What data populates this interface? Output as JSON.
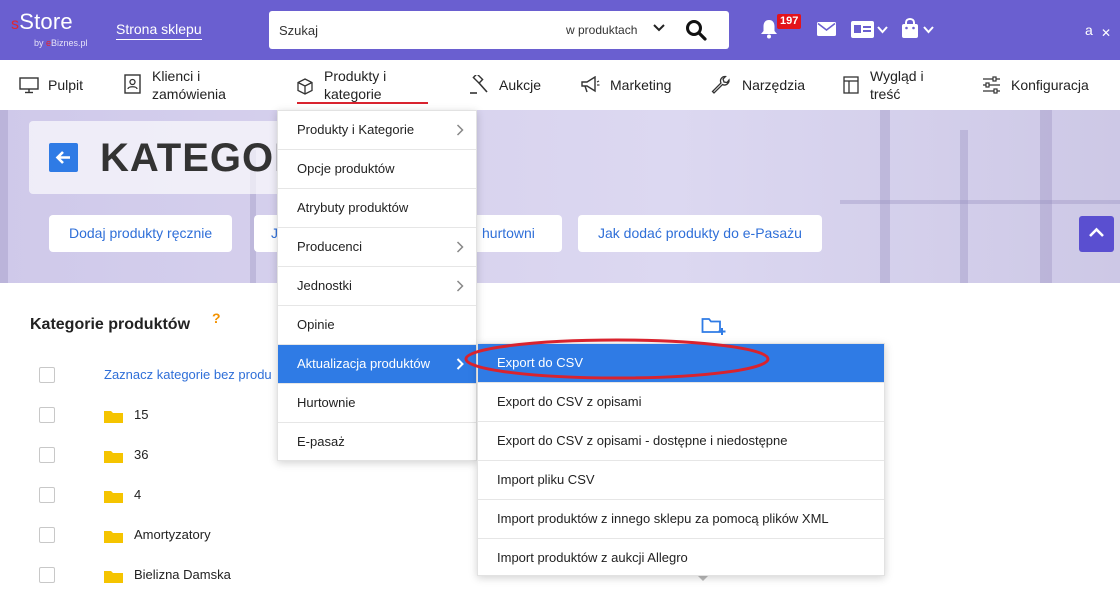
{
  "topbar": {
    "logo_s": "s",
    "logo_main": "Store",
    "logo_by": "by ",
    "logo_e": "e",
    "logo_biznes": "Biznes.pl",
    "shop_link": "Strona sklepu",
    "search_placeholder": "Szukaj",
    "search_scope": "w produktach",
    "notifications_count": "197",
    "user_letter": "a",
    "close_glyph": "✕"
  },
  "nav": {
    "items": [
      {
        "label1": "Pulpit",
        "label2": "",
        "icon": "monitor-icon"
      },
      {
        "label1": "Klienci i",
        "label2": "zamówienia",
        "icon": "client-card-icon"
      },
      {
        "label1": "Produkty i",
        "label2": "kategorie",
        "icon": "box-icon"
      },
      {
        "label1": "Aukcje",
        "label2": "",
        "icon": "gavel-icon"
      },
      {
        "label1": "Marketing",
        "label2": "",
        "icon": "megaphone-icon"
      },
      {
        "label1": "Narzędzia",
        "label2": "",
        "icon": "wrench-icon"
      },
      {
        "label1": "Wygląd i",
        "label2": "treść",
        "icon": "layout-icon"
      },
      {
        "label1": "Konfiguracja",
        "label2": "",
        "icon": "sliders-icon"
      }
    ]
  },
  "banner": {
    "title": "KATEGOR",
    "pills": [
      "Dodaj produkty ręcznie",
      "J",
      "hurtowni",
      "Jak dodać produkty do e-Pasażu"
    ]
  },
  "content": {
    "section_title": "Kategorie produktów",
    "help": "?",
    "select_link": "Zaznacz kategorie bez produ",
    "categories": [
      "15",
      "36",
      "4",
      "Amortyzatory",
      "Bielizna Damska"
    ]
  },
  "dropdown": {
    "items": [
      {
        "label": "Produkty i Kategorie",
        "has_submenu": true
      },
      {
        "label": "Opcje produktów",
        "has_submenu": false
      },
      {
        "label": "Atrybuty produktów",
        "has_submenu": false
      },
      {
        "label": "Producenci",
        "has_submenu": true
      },
      {
        "label": "Jednostki",
        "has_submenu": true
      },
      {
        "label": "Opinie",
        "has_submenu": false
      },
      {
        "label": "Aktualizacja produktów",
        "has_submenu": true,
        "active": true
      },
      {
        "label": "Hurtownie",
        "has_submenu": false
      },
      {
        "label": "E-pasaż",
        "has_submenu": false
      }
    ]
  },
  "submenu": {
    "items": [
      "Export do CSV",
      "Export do CSV z opisami",
      "Export do CSV z opisami - dostępne i niedostępne",
      "Import pliku CSV",
      "Import produktów z innego sklepu za pomocą plików XML",
      "Import produktów z aukcji Allegro"
    ]
  },
  "colors": {
    "topbar": "#6a5fd0",
    "accent_blue": "#2f7be5",
    "badge_red": "#e3131b",
    "highlight_red": "#d9232e",
    "folder_yellow": "#f5c400"
  }
}
